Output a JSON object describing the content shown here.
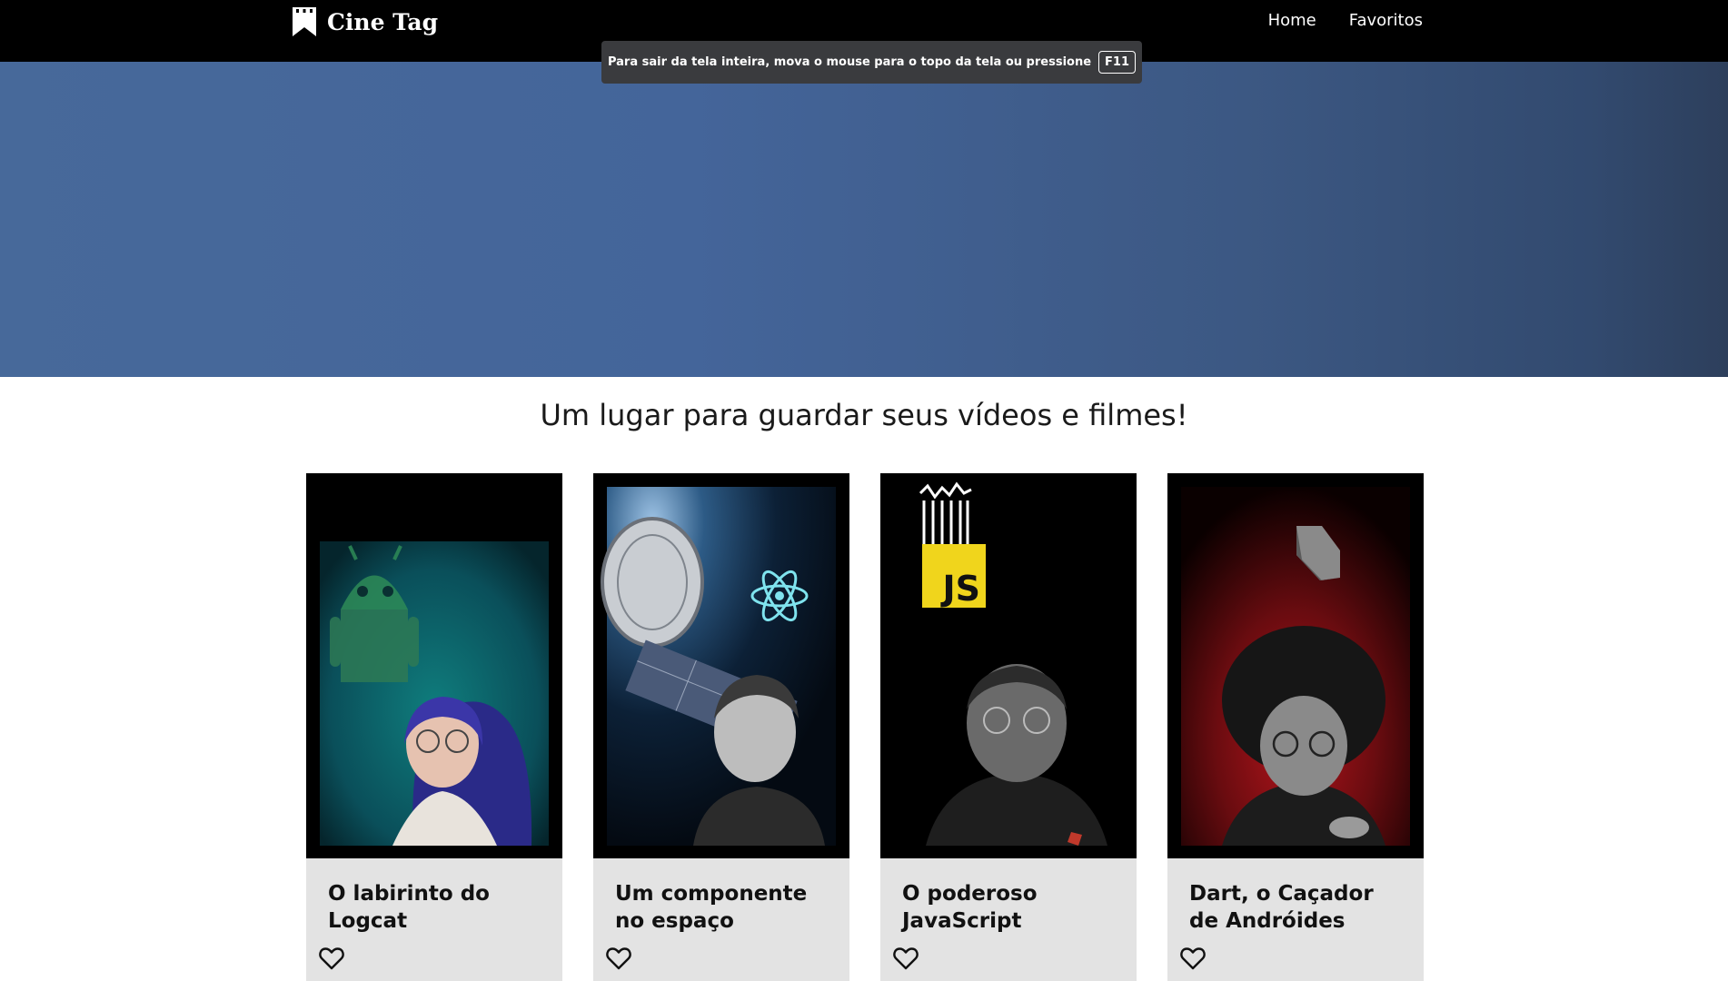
{
  "header": {
    "logo_text": "Cine Tag",
    "nav": [
      {
        "label": "Home"
      },
      {
        "label": "Favoritos"
      }
    ]
  },
  "fullscreen_notice": {
    "text": "Para sair da tela inteira, mova o mouse para o topo da tela ou pressione",
    "key": "F11"
  },
  "tagline": "Um lugar para guardar seus vídeos e filmes!",
  "cards": [
    {
      "title": "O labirinto do Logcat",
      "thumbnail_theme": "android",
      "favorite": false
    },
    {
      "title": "Um componente no espaço",
      "thumbnail_theme": "react-space",
      "favorite": false
    },
    {
      "title": "O poderoso JavaScript",
      "thumbnail_theme": "javascript",
      "badge_text": "JS",
      "favorite": false
    },
    {
      "title": "Dart, o Caçador de Andróides",
      "thumbnail_theme": "dart",
      "favorite": false
    }
  ],
  "colors": {
    "header_bg": "#000000",
    "banner_blue": "#44659a",
    "card_bg": "#e3e3e3",
    "js_yellow": "#f0d51c"
  }
}
